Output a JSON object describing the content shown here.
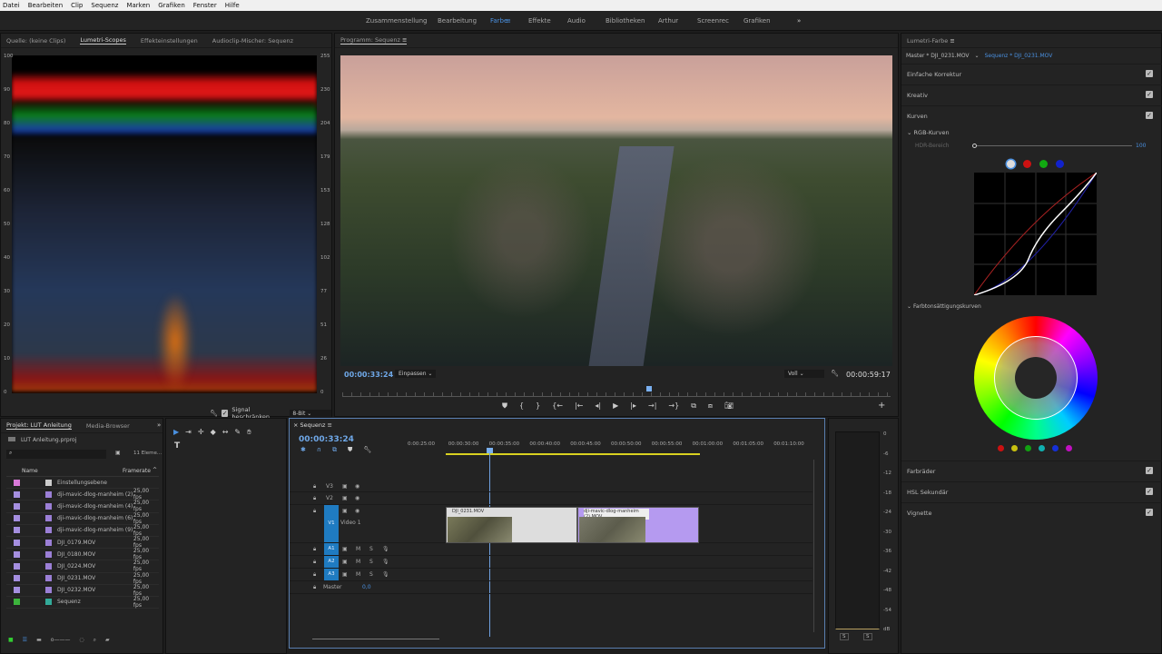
{
  "menu": [
    "Datei",
    "Bearbeiten",
    "Clip",
    "Sequenz",
    "Marken",
    "Grafiken",
    "Fenster",
    "Hilfe"
  ],
  "workspaces": [
    "Zusammenstellung",
    "Bearbeitung",
    "Farbe",
    "Effekte",
    "Audio",
    "Bibliotheken",
    "Arthur",
    "Screenrec",
    "Grafiken"
  ],
  "workspace_active": "Farbe",
  "workspace_more": "»",
  "left_tabs": [
    "Quelle: (keine Clips)",
    "Lumetri-Scopes",
    "Effekteinstellungen",
    "Audioclip-Mischer: Sequenz"
  ],
  "scopes": {
    "left_scale": [
      "100",
      "90",
      "80",
      "70",
      "60",
      "50",
      "40",
      "30",
      "20",
      "10",
      "0"
    ],
    "right_scale": [
      "255",
      "230",
      "204",
      "179",
      "153",
      "128",
      "102",
      "77",
      "51",
      "26",
      "0"
    ],
    "signal_label": "Signal beschränken",
    "bitdepth": "8-Bit"
  },
  "program": {
    "title": "Programm: Sequenz",
    "timecode": "00:00:33:24",
    "fit": "Einpassen",
    "quality": "Voll",
    "duration": "00:00:59:17",
    "playhead_fraction": 0.56
  },
  "lumetri": {
    "title": "Lumetri-Farbe",
    "master": "Master * DJI_0231.MOV",
    "sequence": "Sequenz * DJI_0231.MOV",
    "sections": [
      "Einfache Korrektur",
      "Kreativ",
      "Kurven"
    ],
    "rgb_curves": "RGB-Kurven",
    "hdr_label": "HDR-Bereich",
    "hdr_value": "100",
    "channel_colors": [
      "#dddddd",
      "#cc1111",
      "#11aa11",
      "#1122cc"
    ],
    "hue_sat": "Farbtonsättigungskurven",
    "hue_colors": [
      "#cc1111",
      "#c8c010",
      "#12a012",
      "#10b0b0",
      "#1530d8",
      "#c010c0"
    ],
    "bottom_sections": [
      "Farbräder",
      "HSL Sekundär",
      "Vignette"
    ]
  },
  "project": {
    "tabs": [
      "Projekt: LUT Anleitung",
      "Media-Browser"
    ],
    "file": "LUT Anleitung.prproj",
    "count": "11 Eleme...",
    "col_name": "Name",
    "col_fr": "Framerate",
    "items": [
      {
        "name": "Einstellungsebene",
        "fr": "",
        "color": "#d97ad9"
      },
      {
        "name": "dji-mavic-dlog-manheim (2)",
        "fr": "25,00 fps",
        "color": "#a58fe0"
      },
      {
        "name": "dji-mavic-dlog-manheim (4)",
        "fr": "25,00 fps",
        "color": "#a58fe0"
      },
      {
        "name": "dji-mavic-dlog-manheim (6)",
        "fr": "25,00 fps",
        "color": "#a58fe0"
      },
      {
        "name": "dji-mavic-dlog-manheim (9)",
        "fr": "25,00 fps",
        "color": "#a58fe0"
      },
      {
        "name": "DJI_0179.MOV",
        "fr": "25,00 fps",
        "color": "#a58fe0"
      },
      {
        "name": "DJI_0180.MOV",
        "fr": "25,00 fps",
        "color": "#a58fe0"
      },
      {
        "name": "DJI_0224.MOV",
        "fr": "25,00 fps",
        "color": "#a58fe0"
      },
      {
        "name": "DJI_0231.MOV",
        "fr": "25,00 fps",
        "color": "#a58fe0"
      },
      {
        "name": "DJI_0232.MOV",
        "fr": "25,00 fps",
        "color": "#a58fe0"
      },
      {
        "name": "Sequenz",
        "fr": "25,00 fps",
        "color": "#3cb43c"
      }
    ]
  },
  "timeline": {
    "title": "Sequenz",
    "timecode": "00:00:33:24",
    "ruler": [
      "0:00:25:00",
      "00:00:30:00",
      "00:00:35:00",
      "00:00:40:00",
      "00:00:45:00",
      "00:00:50:00",
      "00:00:55:00",
      "00:01:00:00",
      "00:01:05:00",
      "00:01:10:00"
    ],
    "tracks_video": [
      "V3",
      "V2",
      "V1"
    ],
    "video1": "Video 1",
    "tracks_audio": [
      "A1",
      "A2",
      "A3"
    ],
    "m": "M",
    "s": "S",
    "master": "Master",
    "master_val": "0,0",
    "clips": [
      "DJI_0231.MOV",
      "dji-mavic-dlog-manheim (2).MOV"
    ]
  },
  "meter": {
    "scale": [
      "0",
      "-6",
      "-12",
      "-18",
      "-24",
      "-30",
      "-36",
      "-42",
      "-48",
      "-54",
      "dB"
    ],
    "solo": "S"
  }
}
